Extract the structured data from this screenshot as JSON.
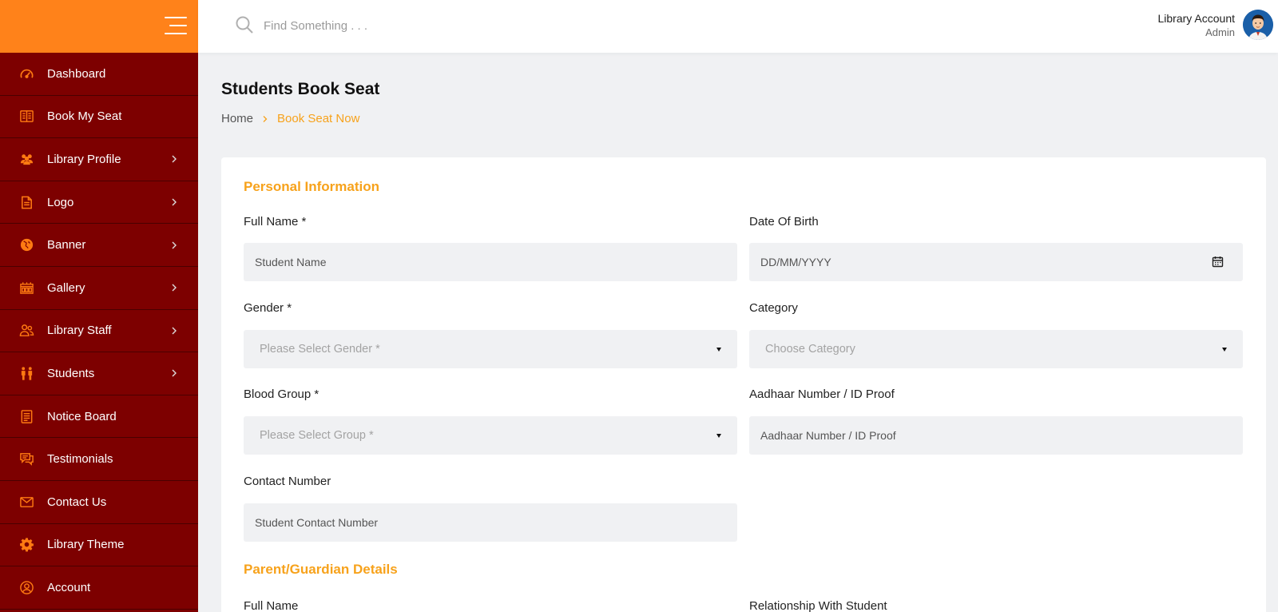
{
  "colors": {
    "sidebar_bg": "#7d0000",
    "sidebar_header": "#ff821a",
    "accent": "#f7a21b",
    "icon_orange": "#ff7a12"
  },
  "sidebar": {
    "items": [
      {
        "label": "Dashboard",
        "icon": "dashboard-gauge-icon",
        "has_chevron": false
      },
      {
        "label": "Book My Seat",
        "icon": "book-icon",
        "has_chevron": false
      },
      {
        "label": "Library Profile",
        "icon": "users-group-icon",
        "has_chevron": true
      },
      {
        "label": "Logo",
        "icon": "document-icon",
        "has_chevron": true
      },
      {
        "label": "Banner",
        "icon": "globe-icon",
        "has_chevron": true
      },
      {
        "label": "Gallery",
        "icon": "gallery-icon",
        "has_chevron": true
      },
      {
        "label": "Library Staff",
        "icon": "staff-icon",
        "has_chevron": true
      },
      {
        "label": "Students",
        "icon": "students-icon",
        "has_chevron": true
      },
      {
        "label": "Notice Board",
        "icon": "notice-board-icon",
        "has_chevron": false
      },
      {
        "label": "Testimonials",
        "icon": "chat-icon",
        "has_chevron": false
      },
      {
        "label": "Contact Us",
        "icon": "envelope-icon",
        "has_chevron": false
      },
      {
        "label": "Library Theme",
        "icon": "gear-icon",
        "has_chevron": false
      },
      {
        "label": "Account",
        "icon": "user-circle-icon",
        "has_chevron": false
      }
    ]
  },
  "topbar": {
    "search_placeholder": "Find Something . . .",
    "account_name": "Library Account",
    "account_role": "Admin"
  },
  "page": {
    "title": "Students Book Seat",
    "breadcrumb_home": "Home",
    "breadcrumb_current": "Book Seat Now"
  },
  "form": {
    "personal_title": "Personal Information",
    "full_name_label": "Full Name *",
    "full_name_placeholder": "Student Name",
    "dob_label": "Date Of Birth",
    "dob_placeholder": "DD/MM/YYYY",
    "gender_label": "Gender *",
    "gender_selected": "Please Select Gender *",
    "category_label": "Category",
    "category_selected": "Choose Category",
    "blood_label": "Blood Group *",
    "blood_selected": "Please Select Group *",
    "aadhaar_label": "Aadhaar Number / ID Proof",
    "aadhaar_placeholder": "Aadhaar Number / ID Proof",
    "contact_label": "Contact Number",
    "contact_placeholder": "Student Contact Number",
    "parent_title": "Parent/Guardian Details",
    "parent_full_name_label": "Full Name",
    "relationship_label": "Relationship With Student"
  }
}
